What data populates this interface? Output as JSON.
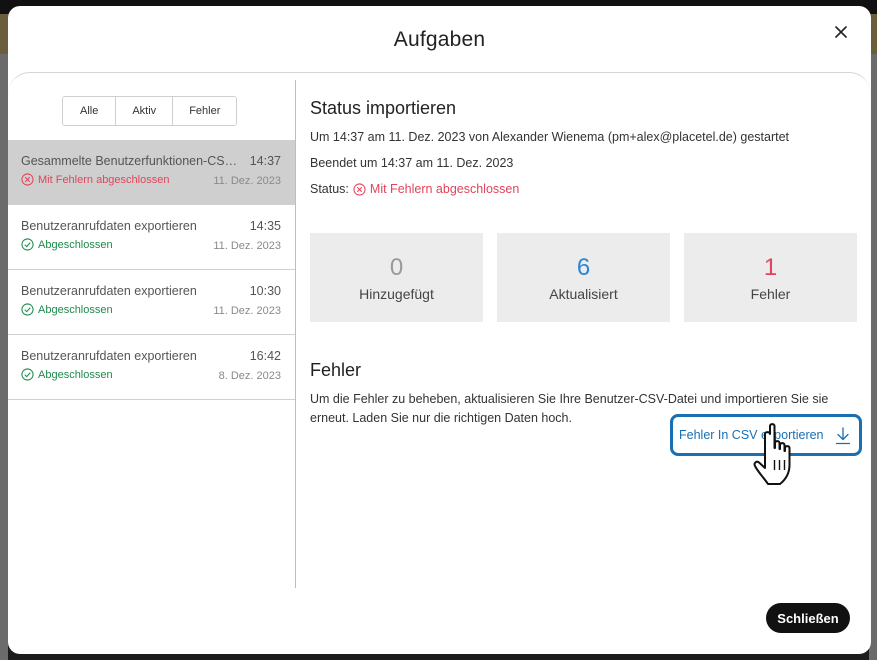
{
  "modal": {
    "title": "Aufgaben",
    "close_label": "Schließen"
  },
  "filters": [
    "Alle",
    "Aktiv",
    "Fehler"
  ],
  "tasks": [
    {
      "name": "Gesammelte Benutzerfunktionen-CSV exportieren",
      "time": "14:37",
      "status": "Mit Fehlern abgeschlossen",
      "status_type": "error",
      "date": "11. Dez. 2023",
      "selected": true
    },
    {
      "name": "Benutzeranrufdaten exportieren",
      "time": "14:35",
      "status": "Abgeschlossen",
      "status_type": "ok",
      "date": "11. Dez. 2023",
      "selected": false
    },
    {
      "name": "Benutzeranrufdaten exportieren",
      "time": "10:30",
      "status": "Abgeschlossen",
      "status_type": "ok",
      "date": "11. Dez. 2023",
      "selected": false
    },
    {
      "name": "Benutzeranrufdaten exportieren",
      "time": "16:42",
      "status": "Abgeschlossen",
      "status_type": "ok",
      "date": "8. Dez. 2023",
      "selected": false
    }
  ],
  "detail": {
    "title": "Status importieren",
    "started": "Um 14:37 am 11. Dez. 2023 von Alexander Wienema (pm+alex@placetel.de) gestartet",
    "ended": "Beendet um 14:37 am 11. Dez. 2023",
    "status_label": "Status:",
    "status_value": "Mit Fehlern abgeschlossen",
    "stats": [
      {
        "value": "0",
        "label": "Hinzugefügt",
        "color": "#9a9a9a"
      },
      {
        "value": "6",
        "label": "Aktualisiert",
        "color": "#2a86d6"
      },
      {
        "value": "1",
        "label": "Fehler",
        "color": "#e0455b"
      }
    ],
    "errors_title": "Fehler",
    "errors_desc": "Um die Fehler zu beheben, aktualisieren Sie Ihre Benutzer-CSV-Datei und importieren Sie sie erneut. Laden Sie nur die richtigen Daten hoch.",
    "export_label": "Fehler In CSV exportieren"
  },
  "colors": {
    "accent": "#1a6fb3",
    "error": "#e0455b",
    "success": "#1e8a4c"
  }
}
